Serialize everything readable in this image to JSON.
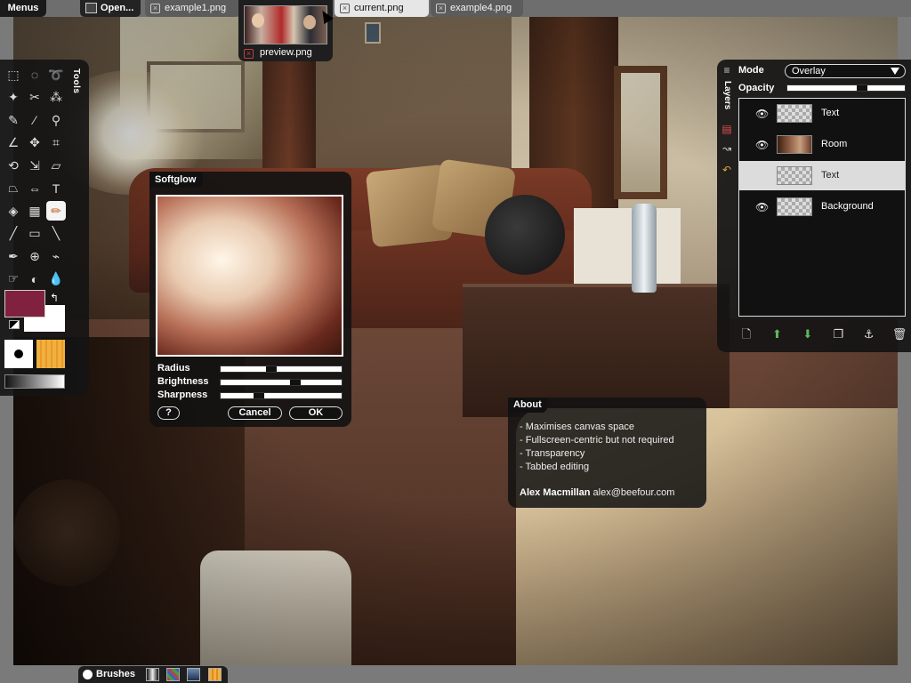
{
  "topbar": {
    "menus_label": "Menus",
    "tabs": [
      {
        "label": "Open...",
        "close_icon": "close-icon"
      },
      {
        "label": "example1.png"
      },
      {
        "label": "current.png",
        "active": true
      },
      {
        "label": "example4.png"
      }
    ]
  },
  "preview": {
    "label": "preview.png"
  },
  "tools": {
    "title": "Tools",
    "icons": [
      "rect-select-icon",
      "ellipse-select-icon",
      "lasso-icon",
      "magic-wand-icon",
      "scissors-icon",
      "fuzzy-select-icon",
      "paths-icon",
      "color-picker-icon",
      "zoom-icon",
      "measure-icon",
      "move-icon",
      "crop-icon",
      "rotate-icon",
      "scale-icon",
      "shear-icon",
      "perspective-icon",
      "flip-icon",
      "text-icon",
      "bucket-fill-icon",
      "blend-icon",
      "pencil-icon",
      "paintbrush-icon",
      "eraser-icon",
      "airbrush-icon",
      "ink-icon",
      "clone-icon",
      "heal-icon",
      "smudge-icon",
      "dodge-burn-icon",
      "blur-icon"
    ],
    "active_index": 20,
    "fg_color": "#80213f",
    "bg_color": "#ffffff"
  },
  "softglow": {
    "title": "Softglow",
    "sliders": [
      {
        "label": "Radius",
        "value": 0.41
      },
      {
        "label": "Brightness",
        "value": 0.63
      },
      {
        "label": "Sharpness",
        "value": 0.3
      }
    ],
    "help_label": "?",
    "cancel_label": "Cancel",
    "ok_label": "OK"
  },
  "about": {
    "title": "About",
    "items": [
      "- Maximises canvas space",
      "- Fullscreen-centric but not required",
      "- Transparency",
      "- Tabbed editing"
    ],
    "author_name": "Alex Macmillan",
    "author_email": "alex@beefour.com"
  },
  "layers": {
    "title": "Layers",
    "mode_label": "Mode",
    "mode_value": "Overlay",
    "opacity_label": "Opacity",
    "opacity_value": 0.65,
    "items": [
      {
        "name": "Text",
        "visible": true,
        "thumb": "transparent"
      },
      {
        "name": "Room",
        "visible": true,
        "thumb": "room"
      },
      {
        "name": "Text",
        "visible": false,
        "thumb": "transparent",
        "selected": true
      },
      {
        "name": "Background",
        "visible": true,
        "thumb": "transparent"
      }
    ],
    "actions": [
      "new-layer-icon",
      "raise-layer-icon",
      "lower-layer-icon",
      "duplicate-layer-icon",
      "anchor-layer-icon",
      "delete-layer-icon"
    ]
  },
  "bottombar": {
    "brushes_label": "Brushes"
  }
}
